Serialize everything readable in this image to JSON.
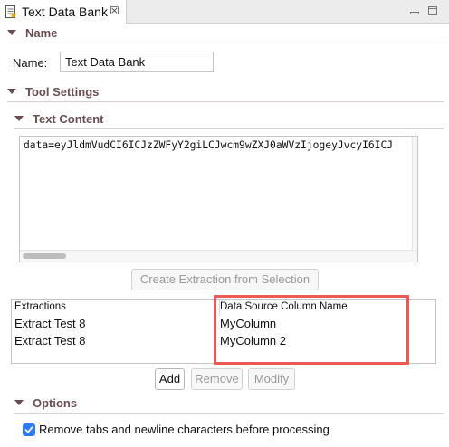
{
  "editor_tab": {
    "title": "Text Data Bank",
    "close_glyph": "☒"
  },
  "sections": {
    "name": "Name",
    "tool_settings": "Tool Settings",
    "text_content": "Text Content",
    "options": "Options"
  },
  "name_field": {
    "label": "Name:",
    "value": "Text Data Bank"
  },
  "text_content": {
    "value": "data=eyJldmVudCI6ICJzZWFyY2giLCJwcm9wZXJ0aWVzIjogeyJvcyI6ICJ"
  },
  "buttons": {
    "create_extraction": "Create Extraction from Selection",
    "add": "Add",
    "remove": "Remove",
    "modify": "Modify"
  },
  "extractions_table": {
    "columns": [
      "Extractions",
      "Data Source Column Name"
    ],
    "rows": [
      {
        "extraction": "Extract Test 8",
        "column": "MyColumn"
      },
      {
        "extraction": "Extract Test 8",
        "column": "MyColumn 2"
      }
    ]
  },
  "options": {
    "remove_tabs_label": "Remove tabs and newline characters before processing",
    "remove_tabs_checked": true
  },
  "colors": {
    "section_header": "#6b4d51",
    "highlight": "#ec5a55",
    "checkbox": "#2f7bf5"
  }
}
